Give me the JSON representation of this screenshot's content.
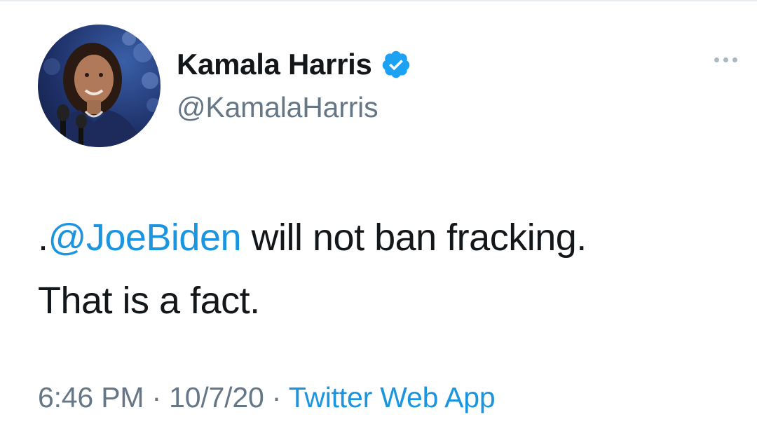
{
  "author": {
    "display_name": "Kamala Harris",
    "handle": "@KamalaHarris",
    "verified": true,
    "verified_color": "#1da1f2"
  },
  "tweet": {
    "prefix": ".",
    "mention": "@JoeBiden",
    "line1_rest": " will not ban fracking.",
    "line2": "That is a fact."
  },
  "meta": {
    "time": "6:46 PM",
    "separator": "·",
    "date": "10/7/20",
    "source": "Twitter Web App"
  },
  "icons": {
    "more": "more-options-icon",
    "verified": "verified-badge-icon"
  },
  "colors": {
    "text": "#14171a",
    "secondary": "#657786",
    "link": "#1b95e0"
  }
}
